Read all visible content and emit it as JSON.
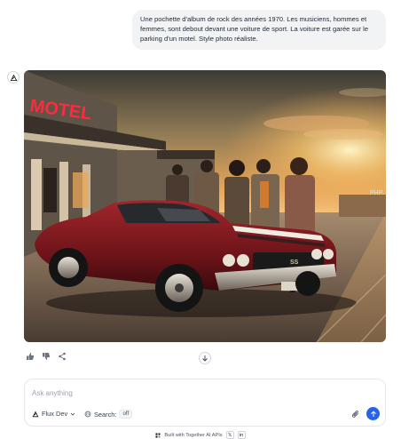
{
  "chat": {
    "user_message": "Une pochette d'album de rock des années 1970. Les musiciens, hommes et femmes, sont debout devant une voiture de sport. La voiture est garée sur le parking d'un motel. Style photo réaliste."
  },
  "image": {
    "sign_text": "MOTEL",
    "badge_text": "SS",
    "far_sign_text": "PHP"
  },
  "composer": {
    "placeholder": "Ask anything",
    "model_label": "Flux Dev",
    "search_label": "Search:",
    "search_state": "off"
  },
  "footer": {
    "text": "Built with Together AI APIs",
    "x_label": "𝕏",
    "linkedin_label": "in"
  },
  "colors": {
    "accent": "#2563eb",
    "bubble": "#f2f3f5"
  }
}
